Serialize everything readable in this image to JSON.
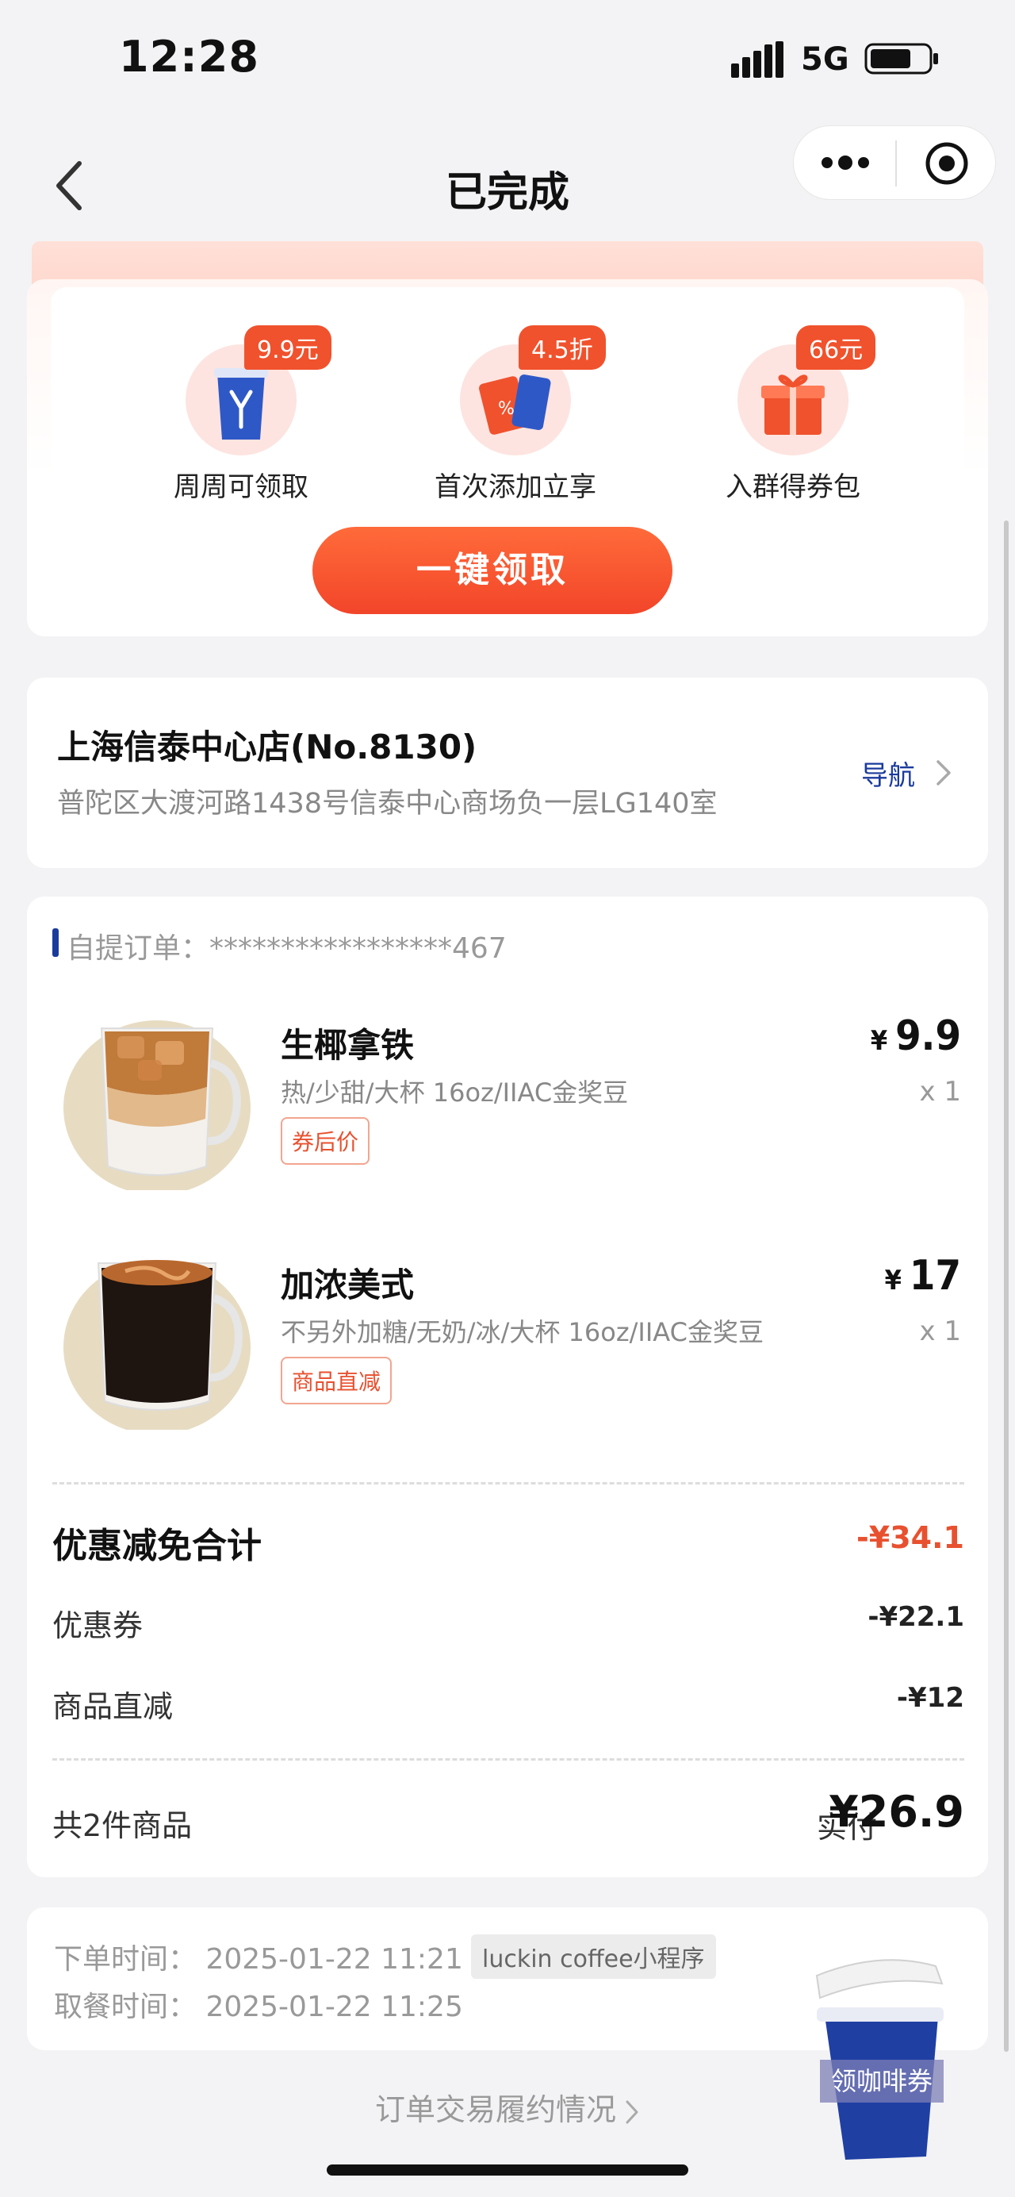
{
  "status_bar": {
    "time": "12:28",
    "network": "5G"
  },
  "nav": {
    "title": "已完成"
  },
  "promo": {
    "items": [
      {
        "tag": "9.9元",
        "label": "周周可领取",
        "icon": "coffee-cup-icon"
      },
      {
        "tag": "4.5折",
        "label": "首次添加立享",
        "icon": "coupon-icon"
      },
      {
        "tag": "66元",
        "label": "入群得券包",
        "icon": "gift-box-icon"
      }
    ],
    "button_label": "一键领取"
  },
  "store": {
    "name": "上海信泰中心店(No.8130)",
    "address": "普陀区大渡河路1438号信泰中心商场负一层LG140室",
    "nav_label": "导航"
  },
  "order": {
    "id_label": "自提订单：",
    "id_value": "*****************467",
    "items": [
      {
        "name": "生椰拿铁",
        "spec": "热/少甜/大杯 16oz/IIAC金奖豆",
        "badge": "券后价",
        "currency": "¥",
        "price": "9.9",
        "qty": "x 1"
      },
      {
        "name": "加浓美式",
        "spec": "不另外加糖/无奶/冰/大杯 16oz/IIAC金奖豆",
        "badge": "商品直减",
        "currency": "¥",
        "price": "17",
        "qty": "x 1"
      }
    ],
    "discount_total_label": "优惠减免合计",
    "discount_total_value": "-¥34.1",
    "coupon_label": "优惠券",
    "coupon_value": "-¥22.1",
    "direct_label": "商品直减",
    "direct_value": "-¥12",
    "count_label": "共2件商品",
    "paid_label": "实付",
    "paid_value": "¥26.9"
  },
  "times": {
    "order_time": "下单时间：   2025-01-22 11:21",
    "source": "luckin coffee小程序",
    "pickup_time": "取餐时间：   2025-01-22 11:25"
  },
  "footer": {
    "fulfil_label": "订单交易履约情况",
    "float_label": "领咖啡券"
  },
  "colors": {
    "accent": "#f0522d",
    "brand_blue": "#1a3b9c",
    "background": "#f3f3f5"
  }
}
